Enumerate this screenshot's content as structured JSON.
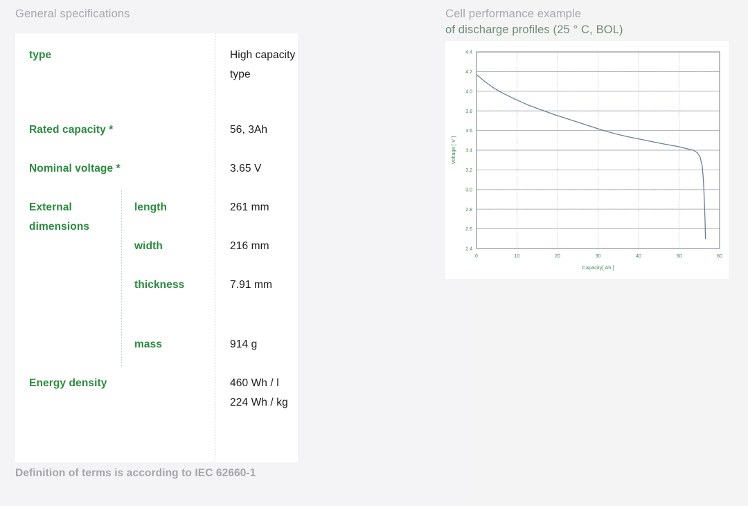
{
  "specs": {
    "heading": "General specifications",
    "rows": [
      {
        "label": "type",
        "sublabel": "",
        "value": "High capacity type"
      },
      {
        "label": "Rated capacity *",
        "sublabel": "",
        "value": "56, 3Ah"
      },
      {
        "label": "Nominal voltage *",
        "sublabel": "",
        "value": "3.65 V"
      },
      {
        "label": "External dimensions",
        "sublabel": "length",
        "value": "261 mm"
      },
      {
        "label": "",
        "sublabel": "width",
        "value": "216 mm"
      },
      {
        "label": "",
        "sublabel": "thickness",
        "value": "7.91 mm"
      },
      {
        "label": "",
        "sublabel": "mass",
        "value": "914 g"
      },
      {
        "label": "Energy density",
        "sublabel": "",
        "value": "460 Wh / l 224 Wh / kg"
      }
    ],
    "footnote": "Definition of terms is according to IEC 62660-1"
  },
  "chart_panel": {
    "heading_line1": "Cell performance example",
    "heading_line2": "of discharge profiles (25 ° C, BOL)"
  },
  "chart_data": {
    "type": "line",
    "title": "Cell performance example of discharge profiles (25 ° C, BOL)",
    "xlabel": "Capacity[ Ah ]",
    "ylabel": "Voltage [ V ]",
    "xlim": [
      0,
      60
    ],
    "ylim": [
      2.4,
      4.4
    ],
    "xticks": [
      0,
      10,
      20,
      30,
      40,
      50,
      60
    ],
    "yticks": [
      2.4,
      2.6,
      2.8,
      3.0,
      3.2,
      3.4,
      3.6,
      3.8,
      4.0,
      4.2,
      4.4
    ],
    "grid": true,
    "legend": false,
    "line_color": "#6b7f99",
    "series": [
      {
        "name": "Discharge profile",
        "x": [
          0,
          2,
          4,
          6,
          8,
          10,
          13,
          16,
          19,
          22,
          25,
          28,
          31,
          34,
          37,
          40,
          43,
          46,
          48,
          50,
          52,
          53.5,
          54.5,
          55.2,
          55.7,
          56.0,
          56.2,
          56.4,
          56.5
        ],
        "y": [
          4.17,
          4.1,
          4.04,
          3.99,
          3.95,
          3.91,
          3.855,
          3.81,
          3.765,
          3.725,
          3.685,
          3.645,
          3.605,
          3.57,
          3.54,
          3.515,
          3.49,
          3.465,
          3.45,
          3.435,
          3.415,
          3.4,
          3.375,
          3.33,
          3.24,
          3.1,
          2.92,
          2.7,
          2.5
        ]
      }
    ]
  }
}
